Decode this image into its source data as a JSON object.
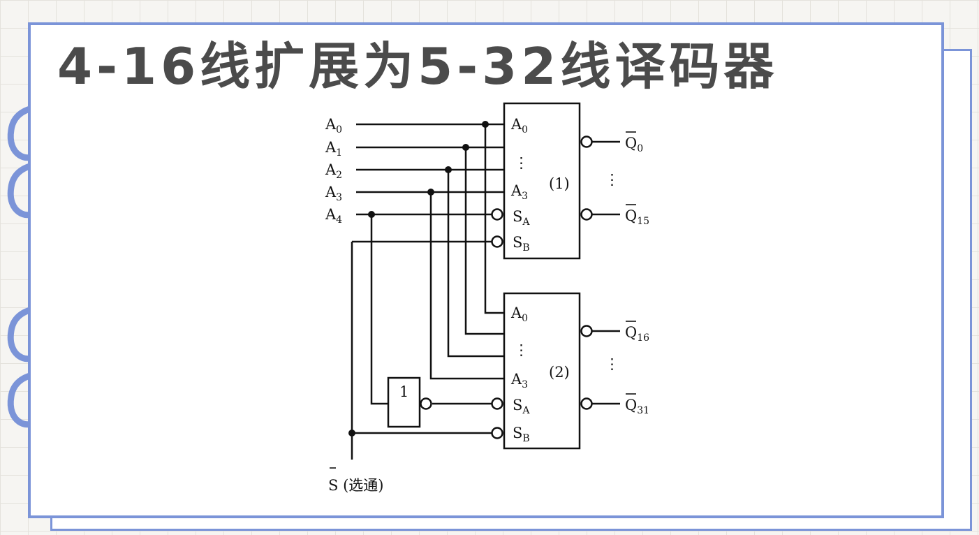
{
  "title": "4-16线扩展为5-32线译码器",
  "icons": {
    "decor": "notebook-ring-icon"
  },
  "colors": {
    "frame": "#7b94d8",
    "title": "#4b4b4b",
    "wire": "#111111"
  },
  "diagram": {
    "inputs": [
      {
        "letter": "A",
        "sub": "0"
      },
      {
        "letter": "A",
        "sub": "1"
      },
      {
        "letter": "A",
        "sub": "2"
      },
      {
        "letter": "A",
        "sub": "3"
      },
      {
        "letter": "A",
        "sub": "4"
      }
    ],
    "strobe": {
      "letter": "S",
      "text": " (选通)"
    },
    "decoder1": {
      "label": "(1)",
      "pins": {
        "a0": {
          "letter": "A",
          "sub": "0"
        },
        "a3": {
          "letter": "A",
          "sub": "3"
        },
        "sa": {
          "letter": "S",
          "sub": "A"
        },
        "sb": {
          "letter": "S",
          "sub": "B"
        }
      },
      "outputs": [
        {
          "letter": "Q",
          "sub": "0"
        },
        {
          "letter": "Q",
          "sub": "15"
        }
      ]
    },
    "decoder2": {
      "label": "(2)",
      "pins": {
        "a0": {
          "letter": "A",
          "sub": "0"
        },
        "a3": {
          "letter": "A",
          "sub": "3"
        },
        "sa": {
          "letter": "S",
          "sub": "A"
        },
        "sb": {
          "letter": "S",
          "sub": "B"
        }
      },
      "outputs": [
        {
          "letter": "Q",
          "sub": "16"
        },
        {
          "letter": "Q",
          "sub": "31"
        }
      ]
    },
    "inverter": {
      "label": "1"
    },
    "ellipsis": "⋮"
  }
}
